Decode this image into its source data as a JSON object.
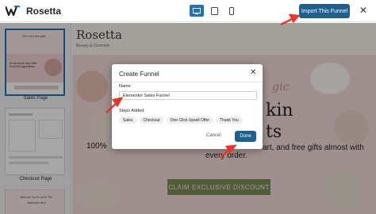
{
  "app": {
    "title": "Rosetta",
    "import_label": "Import This Funnel"
  },
  "sidebar": {
    "items": [
      {
        "label": "Sales Page",
        "selected": true
      },
      {
        "label": "Checkout Page",
        "selected": false
      }
    ],
    "thumb_texts": {
      "sales_line1": "20% off & free gifts",
      "sales_line2": "An Absolute Skin With Powerful Ingredients",
      "next_line1": "Now Are You A Lot Of The",
      "next_line2": "Awesome Item"
    }
  },
  "preview": {
    "brand": "Rosetta",
    "brand_sub": "Beauty & Cosmetic",
    "hero_fragment1": "gic",
    "hero_fragment2": "kin",
    "hero_fragment3": "ts",
    "hero_left": "100%",
    "hero_right": "art, and free gifts almost with",
    "hero_line2": "every order.",
    "cta_label": "CLAIM EXCLUSIVE DISCOUNT"
  },
  "modal": {
    "title": "Create Funnel",
    "name_label": "Name",
    "name_value": "Elementor Sales Funnel",
    "steps_label": "Steps Added",
    "steps": [
      "Sales",
      "Checkout",
      "One Click Upsell Offer",
      "Thank You"
    ],
    "cancel_label": "Cancel",
    "done_label": "Done"
  },
  "colors": {
    "accent": "#1e5f8e",
    "arrow": "#e8362a",
    "cta_green": "#7b8f55",
    "hero_pink": "#f6dcdc"
  }
}
